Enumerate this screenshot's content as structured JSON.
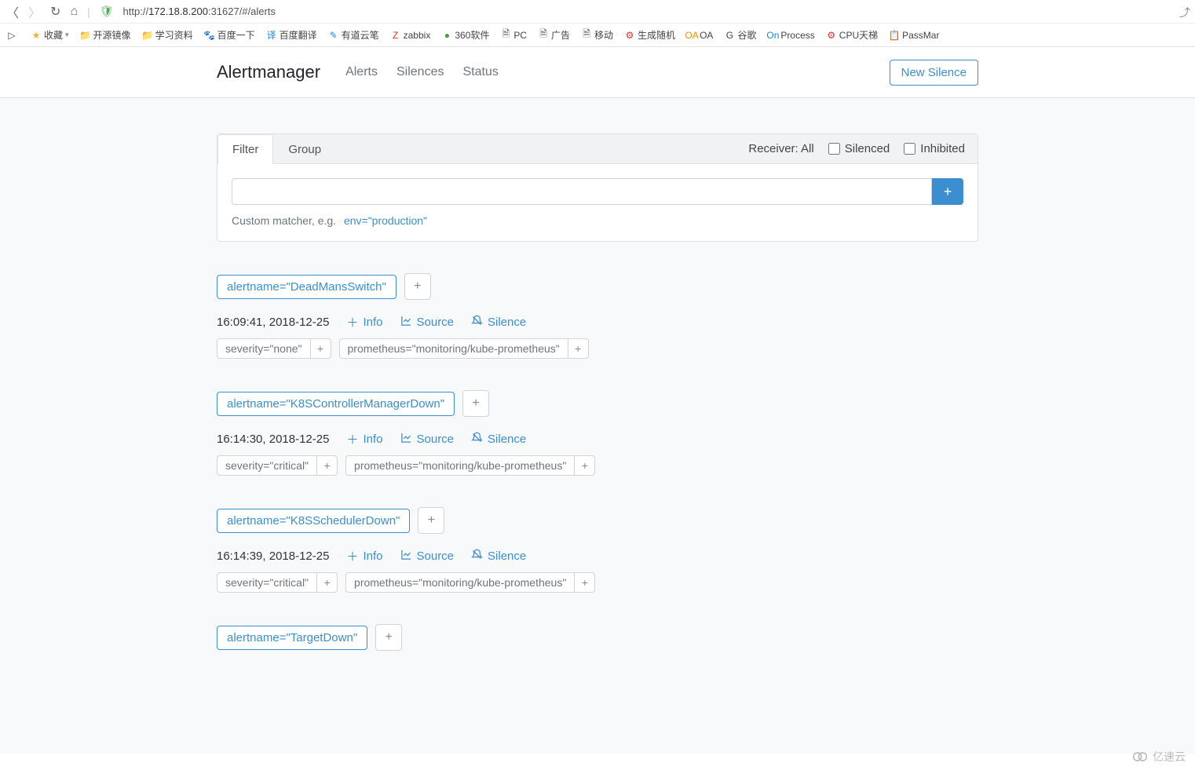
{
  "browser": {
    "url_prefix": "http://",
    "url_host": "172.18.8.200",
    "url_suffix": ":31627/#/alerts"
  },
  "bookmarks": [
    {
      "icon": "▷",
      "label": ""
    },
    {
      "icon": "★",
      "label": "收藏",
      "cls": "star",
      "after": "▾"
    },
    {
      "icon": "📁",
      "label": "开源镜像",
      "cls": "folder"
    },
    {
      "icon": "📁",
      "label": "学习资料",
      "cls": "folder"
    },
    {
      "icon": "🐾",
      "label": "百度一下",
      "cls": "blue"
    },
    {
      "icon": "译",
      "label": "百度翻译",
      "cls": "blue"
    },
    {
      "icon": "✎",
      "label": "有道云笔",
      "cls": "blue"
    },
    {
      "icon": "Z",
      "label": "zabbix",
      "cls": "red"
    },
    {
      "icon": "●",
      "label": "360软件",
      "cls": "green"
    },
    {
      "icon": "🗎",
      "label": "PC"
    },
    {
      "icon": "🗎",
      "label": "广告"
    },
    {
      "icon": "🗎",
      "label": "移动"
    },
    {
      "icon": "⚙",
      "label": "生成随机",
      "cls": "red"
    },
    {
      "icon": "OA",
      "label": "OA",
      "cls": "orange"
    },
    {
      "icon": "G",
      "label": "谷歌"
    },
    {
      "icon": "On",
      "label": "Process",
      "cls": "blue"
    },
    {
      "icon": "⚙",
      "label": "CPU天梯",
      "cls": "red"
    },
    {
      "icon": "📋",
      "label": "PassMar"
    }
  ],
  "app": {
    "brand": "Alertmanager",
    "nav": [
      "Alerts",
      "Silences",
      "Status"
    ],
    "new_silence": "New Silence"
  },
  "filter": {
    "tabs": {
      "filter": "Filter",
      "group": "Group"
    },
    "receiver_label": "Receiver: All",
    "silenced": "Silenced",
    "inhibited": "Inhibited",
    "add": "+",
    "hint_prefix": "Custom matcher, e.g.",
    "hint_example": "env=\"production\""
  },
  "actions": {
    "info": "Info",
    "source": "Source",
    "silence": "Silence",
    "plus": "+"
  },
  "alerts": [
    {
      "name": "alertname=\"DeadMansSwitch\"",
      "time": "16:09:41, 2018-12-25",
      "labels": [
        "severity=\"none\"",
        "prometheus=\"monitoring/kube-prometheus\""
      ]
    },
    {
      "name": "alertname=\"K8SControllerManagerDown\"",
      "time": "16:14:30, 2018-12-25",
      "labels": [
        "severity=\"critical\"",
        "prometheus=\"monitoring/kube-prometheus\""
      ]
    },
    {
      "name": "alertname=\"K8SSchedulerDown\"",
      "time": "16:14:39, 2018-12-25",
      "labels": [
        "severity=\"critical\"",
        "prometheus=\"monitoring/kube-prometheus\""
      ]
    },
    {
      "name": "alertname=\"TargetDown\"",
      "time": "",
      "labels": []
    }
  ],
  "watermark": "亿速云"
}
